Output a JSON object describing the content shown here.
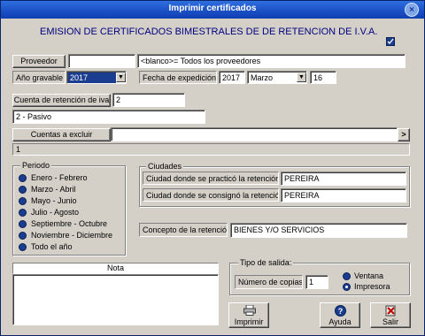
{
  "window": {
    "title": "Imprimir certificados",
    "close_label": "×"
  },
  "header": {
    "title": "EMISION DE CERTIFICADOS BIMESTRALES DE DE RETENCION DE  I.V.A."
  },
  "proveedor": {
    "button_label": "Proveedor",
    "value": "",
    "hint": "<blanco>= Todos los proveedores"
  },
  "ano": {
    "label": "Año gravable",
    "value": "2017"
  },
  "fecha": {
    "label": "Fecha de expedición",
    "year": "2017",
    "month": "Marzo",
    "day": "16"
  },
  "cuenta": {
    "button_label": "Cuenta de retención de iva",
    "code": "2",
    "description": "2 - Pasivo"
  },
  "excluir": {
    "button_label": "Cuentas a excluir",
    "value": "",
    "list_value": "1",
    "arrow": ">"
  },
  "periodo": {
    "legend": "Periodo",
    "options": [
      "Enero - Febrero",
      "Marzo - Abril",
      "Mayo - Junio",
      "Julio - Agosto",
      "Septiembre - Octubre",
      "Noviembre - Diciembre",
      "Todo el año"
    ]
  },
  "ciudades": {
    "legend": "Ciudades",
    "practico_label": "Ciudad donde se practicó la retención",
    "practico_value": "PEREIRA",
    "consigno_label": "Ciudad donde se consignó la retención",
    "consigno_value": "PEREIRA"
  },
  "concepto": {
    "label": "Concepto de la retención",
    "value": "BIENES Y/O SERVICIOS"
  },
  "nota": {
    "label": "Nota",
    "value": ""
  },
  "salida": {
    "legend": "Tipo de salida:",
    "copias_label": "Número de copias",
    "copias_value": "1",
    "options": [
      "Ventana",
      "Impresora"
    ]
  },
  "buttons": {
    "imprimir": "Imprimir",
    "ayuda": "Ayuda",
    "salir": "Salir"
  },
  "colors": {
    "title_bar": "#1a4fc4",
    "header_text": "#000080",
    "radio": "#1a3d8f"
  }
}
